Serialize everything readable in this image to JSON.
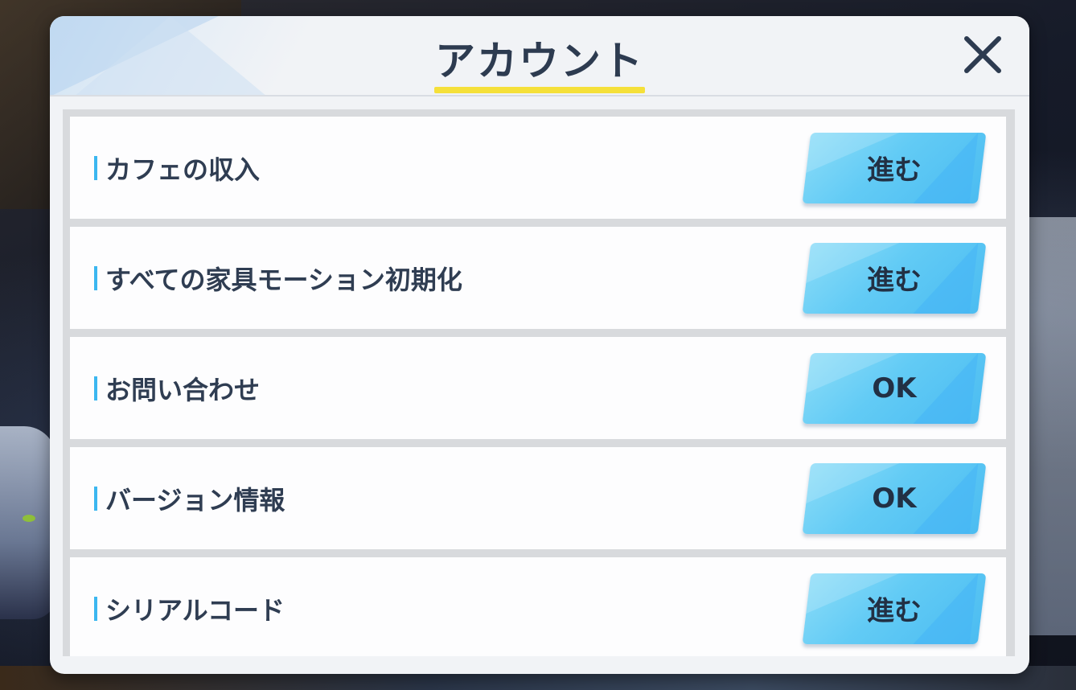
{
  "dialog": {
    "title": "アカウント",
    "close_icon": "close-icon"
  },
  "rows": [
    {
      "label": "カフェの収入",
      "button": "進む"
    },
    {
      "label": "すべての家具モーション初期化",
      "button": "進む"
    },
    {
      "label": "お問い合わせ",
      "button": "OK"
    },
    {
      "label": "バージョン情報",
      "button": "OK"
    },
    {
      "label": "シリアルコード",
      "button": "進む"
    }
  ],
  "colors": {
    "accent_button": "#62cbf5",
    "title_underline": "#f5e03a",
    "label_bar": "#3bb7f0",
    "text": "#2f3d52"
  }
}
